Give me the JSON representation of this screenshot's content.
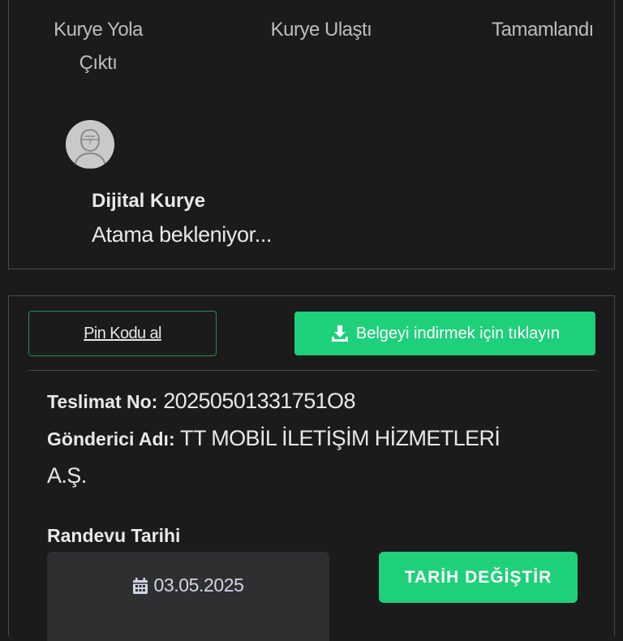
{
  "tracking": {
    "steps": [
      "Kurye Yola Çıktı",
      "Kurye Ulaştı",
      "Tamamlandı"
    ]
  },
  "courier": {
    "name": "Dijital Kurye",
    "status": "Atama bekleniyor..."
  },
  "actions": {
    "pin_label": "Pin Kodu al",
    "download_label": "Belgeyi indirmek için tıklayın"
  },
  "delivery": {
    "tracking_label": "Teslimat No",
    "tracking_value": "20250501331751O8",
    "sender_label": "Gönderici Adı",
    "sender_value_line1": "TT MOBİL İLETİŞİM HİZMETLERİ",
    "sender_value_line2": "A.Ş."
  },
  "appointment": {
    "label": "Randevu Tarihi",
    "date": "03.05.2025",
    "change_label": "TARİH DEĞİŞTİR"
  },
  "colors": {
    "accent": "#1fd07a",
    "background": "#1b1b1c",
    "border": "#4a4a4c"
  }
}
